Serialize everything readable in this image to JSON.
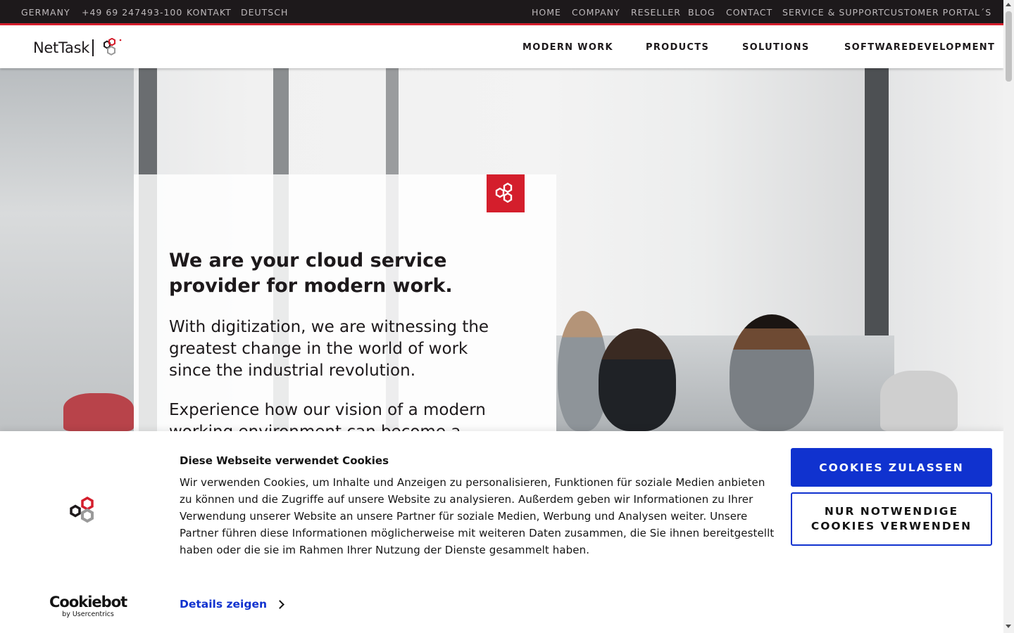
{
  "topbar": {
    "left": [
      "GERMANY",
      "+49 69 247493-100",
      "KONTAKT",
      "DEUTSCH"
    ],
    "right": [
      "HOME",
      "COMPANY",
      "RESELLER",
      "BLOG",
      "CONTACT",
      "SERVICE & SUPPORT",
      "CUSTOMER PORTAL´S"
    ]
  },
  "brand": {
    "name": "NetTask",
    "accent": "#d41e2c",
    "dark": "#1d191b"
  },
  "nav": [
    "MODERN WORK",
    "PRODUCTS",
    "SOLUTIONS",
    "SOFTWAREDEVELOPMENT"
  ],
  "hero": {
    "title": "We are your cloud service provider for modern work.",
    "p1": "With digitization, we are witnessing the greatest change in the world of work since the industrial revolution.",
    "p2": "Experience how our vision of a modern working environment can become a"
  },
  "cookie": {
    "title": "Diese Webseite verwendet Cookies",
    "body": "Wir verwenden Cookies, um Inhalte und Anzeigen zu personalisieren, Funktionen für soziale Medien anbieten zu können und die Zugriffe auf unsere Website zu analysieren. Außerdem geben wir Informationen zu Ihrer Verwendung unserer Website an unsere Partner für soziale Medien, Werbung und Analysen weiter. Unsere Partner führen diese Informationen möglicherweise mit weiteren Daten zusammen, die Sie ihnen bereitgestellt haben oder die sie im Rahmen Ihrer Nutzung der Dienste gesammelt haben.",
    "details": "Details zeigen",
    "allow": "COOKIES ZULASSEN",
    "necessary": "NUR NOTWENDIGE COOKIES VERWENDEN",
    "provider": "Cookiebot",
    "provider_sub": "by Usercentrics",
    "button_color": "#1032cf"
  }
}
